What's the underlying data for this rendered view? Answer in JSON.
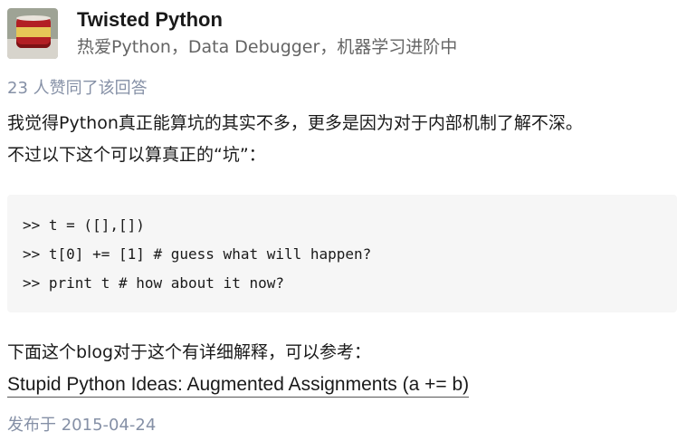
{
  "author": {
    "name": "Twisted Python",
    "headline": "热爱Python，Data Debugger，机器学习进阶中"
  },
  "votes_text": "23 人赞同了该回答",
  "paragraphs": [
    "我觉得Python真正能算坑的其实不多，更多是因为对于内部机制了解不深。",
    "不过以下这个可以算真正的“坑”："
  ],
  "code": [
    ">> t = ([],[])",
    ">> t[0] += [1] # guess what will happen?",
    ">> print t # how about it now?"
  ],
  "reference_text": "下面这个blog对于这个有详细解释，可以参考：",
  "link_text": "Stupid Python Ideas: Augmented Assignments (a += b)",
  "published": "发布于 2015-04-24",
  "colors": {
    "meta": "#8590a6",
    "code_bg": "#f6f6f6",
    "text": "#1a1a1a"
  }
}
